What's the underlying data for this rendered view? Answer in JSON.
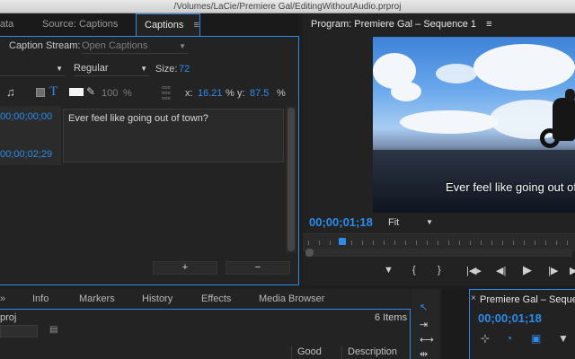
{
  "window": {
    "title": "/Volumes/LaCie/Premiere Gal/EditingWithoutAudio.prproj"
  },
  "left_panel": {
    "tabs": [
      {
        "label": "ata"
      },
      {
        "label": "Source: Captions"
      },
      {
        "label": "Captions",
        "active": true
      }
    ],
    "tab_menu_icon": "≡",
    "caption_stream_label": "Caption Stream:",
    "caption_stream_value": "Open Captions",
    "font_style": "Regular",
    "size_label": "Size:",
    "size_value": "72",
    "opacity_value": "100",
    "opacity_unit": "%",
    "x_label": "x:",
    "x_value": "16.21",
    "x_unit": "%",
    "y_label": "y:",
    "y_value": "87.5",
    "y_unit": "%",
    "caption": {
      "in_time": "00;00;00;00",
      "out_time": "00;00;02;29",
      "text": "Ever feel like going out of town?"
    },
    "add_button": "+",
    "remove_button": "−"
  },
  "program": {
    "title": "Program: Premiere Gal – Sequence 1",
    "menu_icon": "≡",
    "caption_overlay": "Ever feel like going out of",
    "timecode": "00;00;01;18",
    "fit_label": "Fit",
    "controls": [
      "▼",
      "{",
      "}",
      "|◀▸",
      "◀|",
      "▶",
      "|▶",
      "▶▶"
    ]
  },
  "bottom_left": {
    "tabs": [
      "Info",
      "Markers",
      "History",
      "Effects",
      "Media Browser"
    ],
    "project_name": "proj",
    "items_count": "6 Items",
    "columns": [
      "Good",
      "Description"
    ]
  },
  "timeline": {
    "close_icon": "×",
    "title": "Premiere Gal – Seque",
    "timecode": "00;00;01;18"
  },
  "colors": {
    "accent": "#2d8ceb",
    "panel_bg": "#232323",
    "text": "#b8b8b8"
  }
}
